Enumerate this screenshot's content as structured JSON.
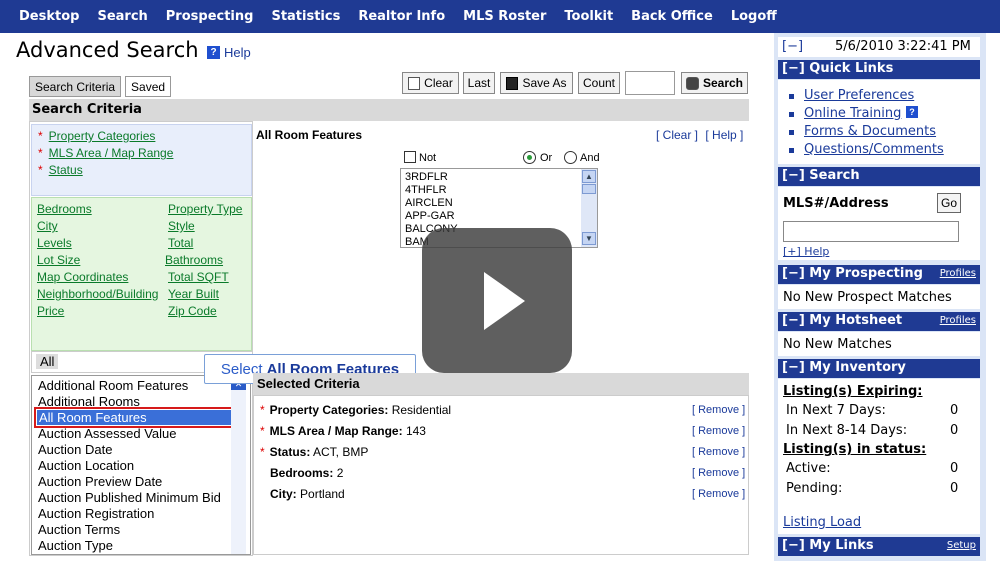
{
  "nav": [
    "Desktop",
    "Search",
    "Prospecting",
    "Statistics",
    "Realtor Info",
    "MLS Roster",
    "Toolkit",
    "Back Office",
    "Logoff"
  ],
  "page": {
    "title": "Advanced Search",
    "help": "Help"
  },
  "tabs": {
    "criteria": "Search Criteria",
    "saved": "Saved"
  },
  "toolbar": {
    "clear": "Clear",
    "last": "Last",
    "save_as": "Save As",
    "count": "Count",
    "search": "Search"
  },
  "section_header": "Search Criteria",
  "required_fields": [
    "Property Categories",
    "MLS Area / Map Range",
    "Status"
  ],
  "fields_left": [
    "Bedrooms",
    "City",
    "Levels",
    "Lot Size",
    "Map Coordinates",
    "Neighborhood/Building",
    "Price"
  ],
  "fields_right": [
    "Property Type",
    "Style",
    "Total",
    "Bathrooms",
    "Total SQFT",
    "Year Built",
    "Zip Code"
  ],
  "all_label": "All",
  "list_items": [
    "Additional Room Features",
    "Additional Rooms",
    "All Room Features",
    "Auction Assessed Value",
    "Auction Date",
    "Auction Location",
    "Auction Preview Date",
    "Auction Published Minimum Bid",
    "Auction Registration",
    "Auction Terms",
    "Auction Type"
  ],
  "callout": {
    "prefix": "Select",
    "bold": "All Room Features"
  },
  "room_features": {
    "title": "All Room Features",
    "clear": "[ Clear ]",
    "help": "[ Help ]",
    "not": "Not",
    "or": "Or",
    "and": "And",
    "options": [
      "3RDFLR",
      "4THFLR",
      "AIRCLEN",
      "APP-GAR",
      "BALCONY",
      "BAM"
    ]
  },
  "selected": {
    "header": "Selected Criteria",
    "remove": "[ Remove ]",
    "rows": [
      {
        "label": "Property Categories:",
        "value": "Residential",
        "required": "*"
      },
      {
        "label": "MLS Area / Map Range:",
        "value": "143",
        "required": "*"
      },
      {
        "label": "Status:",
        "value": "ACT, BMP",
        "required": "*"
      },
      {
        "label": "Bedrooms:",
        "value": "2",
        "required": ""
      },
      {
        "label": "City:",
        "value": "Portland",
        "required": ""
      }
    ]
  },
  "sidebar": {
    "toggle": "[−]",
    "datetime": "5/6/2010 3:22:41 PM",
    "quick_links": "[−] Quick Links",
    "links": [
      "User Preferences",
      "Online Training",
      "Forms & Documents",
      "Questions/Comments"
    ],
    "search": "[−] Search",
    "mls_label": "MLS#/Address",
    "go": "Go",
    "plus_help": "[+] Help",
    "prospecting": "[−] My Prospecting",
    "profiles": "Profiles",
    "no_prospect": "No New Prospect Matches",
    "hotsheet": "[−] My Hotsheet",
    "no_matches": "No New Matches",
    "inventory": "[−] My Inventory",
    "expiring": "Listing(s) Expiring:",
    "next7": "In Next 7 Days:",
    "next7_val": "0",
    "next814": "In Next 8-14 Days:",
    "next814_val": "0",
    "in_status": "Listing(s) in status:",
    "active": "Active:",
    "active_val": "0",
    "pending": "Pending:",
    "pending_val": "0",
    "listing_load": "Listing Load",
    "my_links": "[−] My Links",
    "setup": "Setup"
  }
}
